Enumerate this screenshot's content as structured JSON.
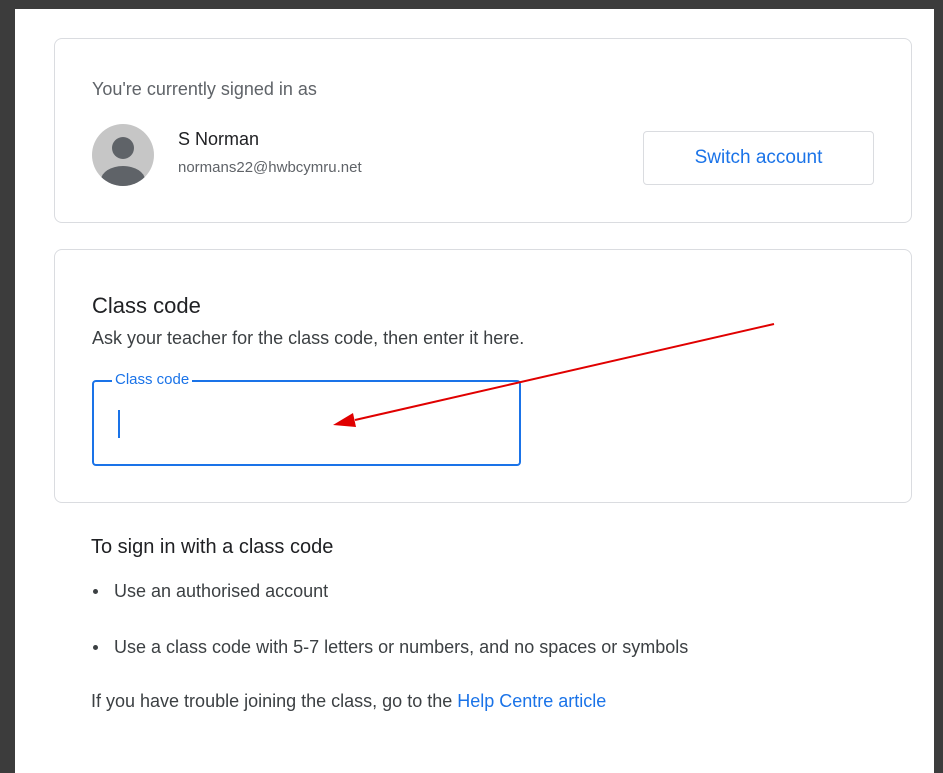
{
  "account": {
    "signed_in_label": "You're currently signed in as",
    "name": "S Norman",
    "email": "normans22@hwbcymru.net",
    "switch_label": "Switch account"
  },
  "class_code": {
    "title": "Class code",
    "description": "Ask your teacher for the class code, then enter it here.",
    "field_label": "Class code",
    "field_value": ""
  },
  "instructions": {
    "title": "To sign in with a class code",
    "bullets": [
      "Use an authorised account",
      "Use a class code with 5-7 letters or numbers, and no spaces or symbols"
    ],
    "help_text": "If you have trouble joining the class, go to the ",
    "help_link": "Help Centre article"
  },
  "colors": {
    "accent": "#1a73e8",
    "annotation_arrow": "#e00000",
    "border": "#dadce0"
  },
  "icons": {
    "avatar": "person-avatar-icon",
    "annotation": "red-arrow-annotation-icon"
  }
}
